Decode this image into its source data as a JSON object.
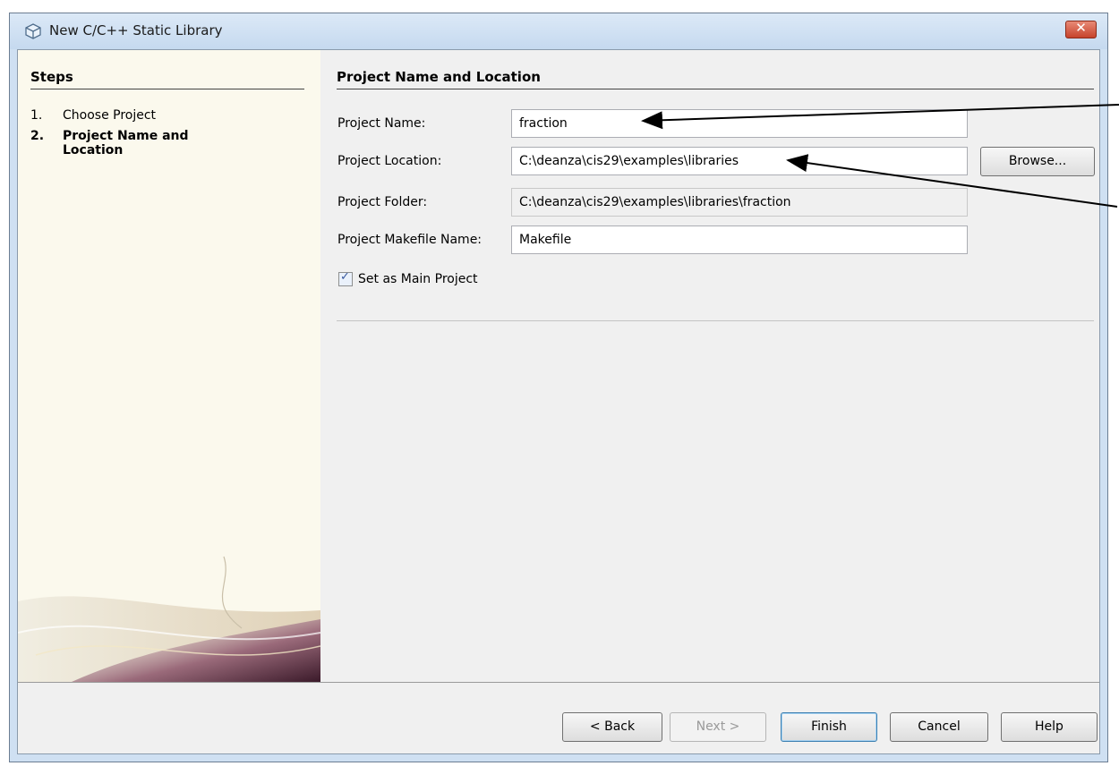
{
  "window": {
    "title": "New C/C++ Static Library",
    "close_glyph": "✕"
  },
  "steps": {
    "title": "Steps",
    "items": [
      {
        "num": "1.",
        "label": "Choose Project"
      },
      {
        "num": "2.",
        "label": "Project Name and Location"
      }
    ]
  },
  "main": {
    "title": "Project Name and Location",
    "project_name_label": "Project Name:",
    "project_name_value": "fraction",
    "project_location_label": "Project Location:",
    "project_location_value": "C:\\deanza\\cis29\\examples\\libraries",
    "project_folder_label": "Project Folder:",
    "project_folder_value": "C:\\deanza\\cis29\\examples\\libraries\\fraction",
    "makefile_label": "Project Makefile Name:",
    "makefile_value": "Makefile",
    "browse_label": "Browse...",
    "main_project_label": "Set as Main Project",
    "main_project_checked": true
  },
  "buttons": {
    "back": "< Back",
    "next": "Next >",
    "finish": "Finish",
    "cancel": "Cancel",
    "help": "Help"
  },
  "colors": {
    "steps_bg": "#fbf9ed",
    "content_bg": "#f0f0f0",
    "title_bar": "#cfe0f2",
    "close_red": "#c6432c"
  }
}
